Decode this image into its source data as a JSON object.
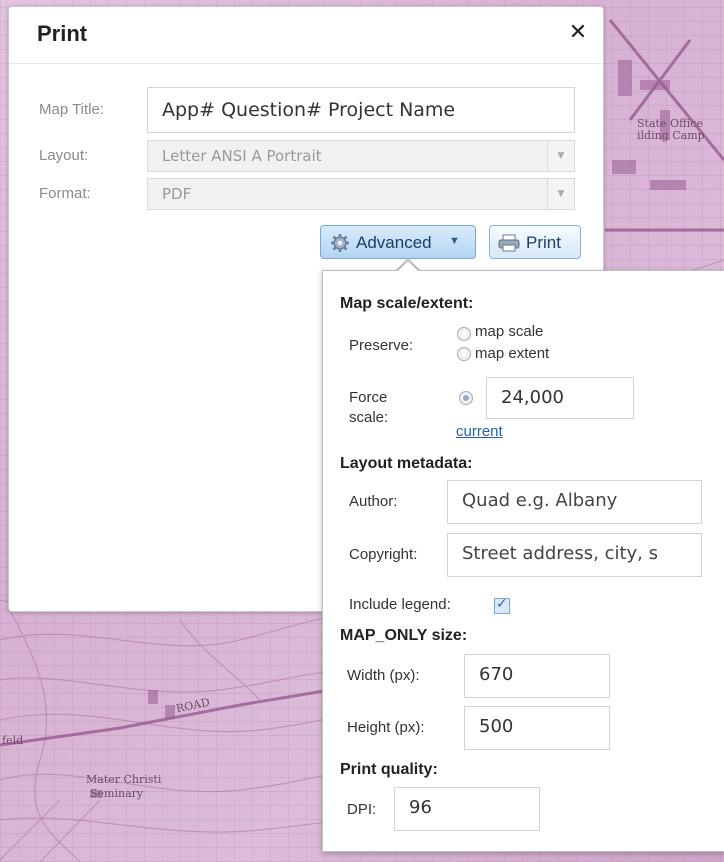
{
  "map": {
    "labels": {
      "state_office": "State Office",
      "building_campus": "ilding Camp",
      "road": "ROAD",
      "field_left": "feld",
      "mater_christi": "Mater Christi",
      "seminary": "Seminary"
    }
  },
  "dialog": {
    "title": "Print",
    "close_icon": "close-icon",
    "map_title_label": "Map Title:",
    "map_title_value": "App# Question# Project Name",
    "layout_label": "Layout:",
    "layout_value": "Letter ANSI A Portrait",
    "format_label": "Format:",
    "format_value": "PDF",
    "advanced_button": "Advanced",
    "print_button": "Print"
  },
  "advanced": {
    "scale_heading": "Map scale/extent:",
    "preserve_label": "Preserve:",
    "preserve_options": [
      "map scale",
      "map extent"
    ],
    "force_scale_label_1": "Force",
    "force_scale_label_2": "scale:",
    "force_scale_value": "24,000",
    "current_link": "current",
    "layout_metadata_heading": "Layout metadata:",
    "author_label": "Author:",
    "author_placeholder": "Quad e.g. Albany",
    "copyright_label": "Copyright:",
    "copyright_placeholder": "Street address, city, s",
    "include_legend_label": "Include legend:",
    "include_legend_checked": true,
    "map_only_heading": "MAP_ONLY size:",
    "width_label": "Width (px):",
    "width_value": "670",
    "height_label": "Height (px):",
    "height_value": "500",
    "print_quality_heading": "Print quality:",
    "dpi_label": "DPI:",
    "dpi_value": "96"
  }
}
